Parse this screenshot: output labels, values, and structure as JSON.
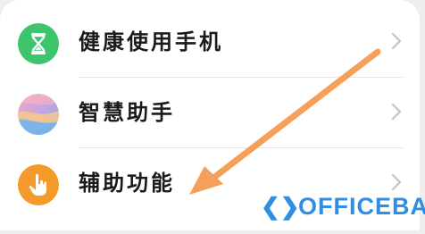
{
  "settings": {
    "items": [
      {
        "label": "健康使用手机",
        "icon": "hourglass-icon",
        "icon_color": "#3ec46d"
      },
      {
        "label": "智慧助手",
        "icon": "smart-assistant-icon",
        "icon_color": "#c9a6e0"
      },
      {
        "label": "辅助功能",
        "icon": "accessibility-hand-icon",
        "icon_color": "#f39a2b"
      }
    ]
  },
  "annotation": {
    "arrow_color": "#f4a05a"
  },
  "watermark": {
    "text": "OFFICEBA",
    "color": "#2f8de4"
  }
}
